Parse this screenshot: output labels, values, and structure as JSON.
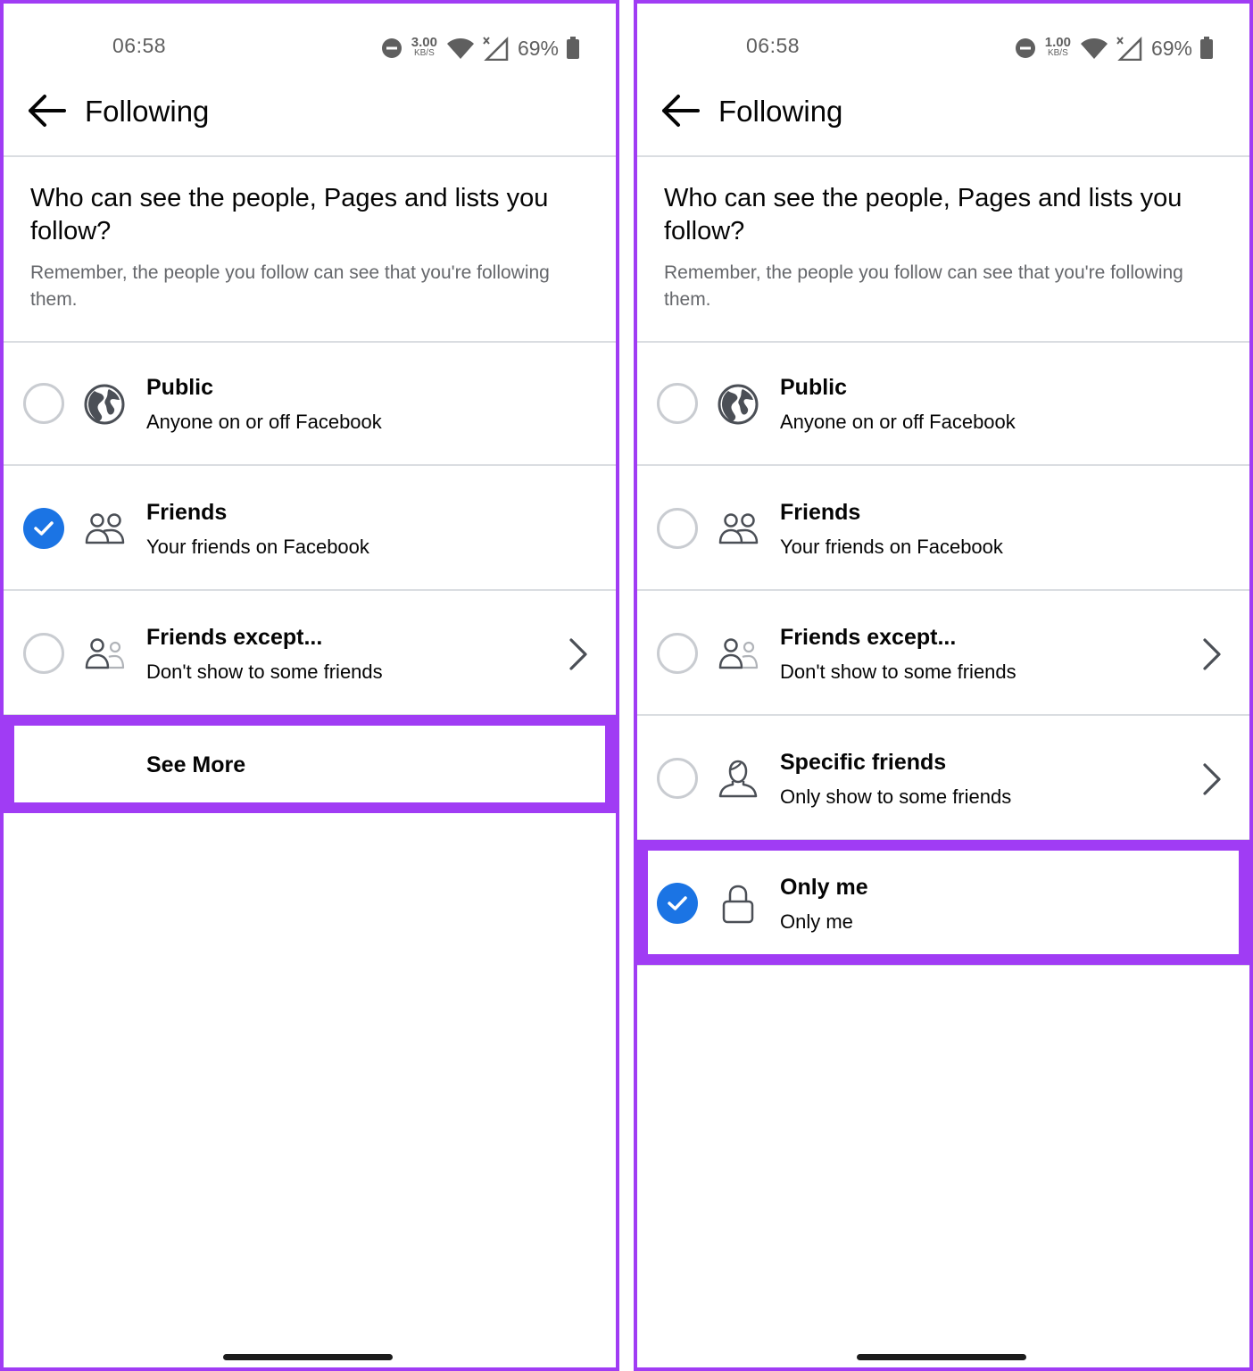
{
  "screens": [
    {
      "status": {
        "time": "06:58",
        "speed_value": "3.00",
        "speed_unit": "KB/S",
        "battery": "69%"
      },
      "header": {
        "title": "Following"
      },
      "intro": {
        "question": "Who can see the people, Pages and lists you follow?",
        "note": "Remember, the people you follow can see that you're following them."
      },
      "options": [
        {
          "label": "Public",
          "sub": "Anyone on or off Facebook",
          "icon": "globe-icon",
          "checked": false
        },
        {
          "label": "Friends",
          "sub": "Your friends on Facebook",
          "icon": "friends-icon",
          "checked": true
        },
        {
          "label": "Friends except...",
          "sub": "Don't show to some friends",
          "icon": "friends-except-icon",
          "checked": false,
          "chevron": true
        }
      ],
      "see_more": "See More"
    },
    {
      "status": {
        "time": "06:58",
        "speed_value": "1.00",
        "speed_unit": "KB/S",
        "battery": "69%"
      },
      "header": {
        "title": "Following"
      },
      "intro": {
        "question": "Who can see the people, Pages and lists you follow?",
        "note": "Remember, the people you follow can see that you're following them."
      },
      "options": [
        {
          "label": "Public",
          "sub": "Anyone on or off Facebook",
          "icon": "globe-icon",
          "checked": false
        },
        {
          "label": "Friends",
          "sub": "Your friends on Facebook",
          "icon": "friends-icon",
          "checked": false
        },
        {
          "label": "Friends except...",
          "sub": "Don't show to some friends",
          "icon": "friends-except-icon",
          "checked": false,
          "chevron": true
        },
        {
          "label": "Specific friends",
          "sub": "Only show to some friends",
          "icon": "specific-friend-icon",
          "checked": false,
          "chevron": true
        },
        {
          "label": "Only me",
          "sub": "Only me",
          "icon": "lock-icon",
          "checked": true
        }
      ]
    }
  ],
  "colors": {
    "highlight": "#a03cf4",
    "accent": "#1b74e4",
    "divider": "#dadde1",
    "secondary_text": "#65676b"
  }
}
